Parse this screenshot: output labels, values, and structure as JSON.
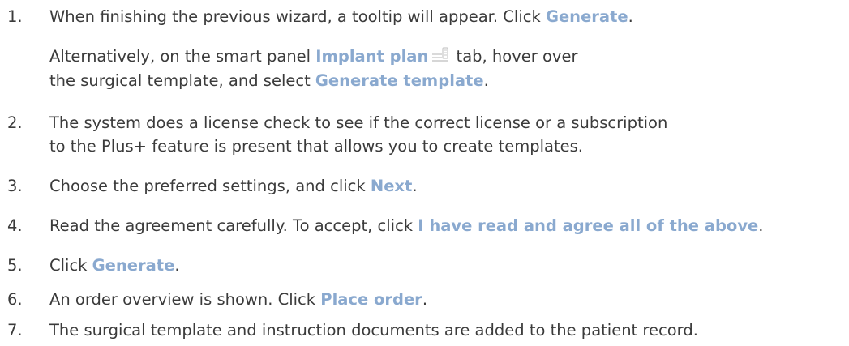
{
  "steps": [
    {
      "number": "1.",
      "text_before": "When finishing the previous wizard, a tooltip will appear. Click ",
      "action": "Generate",
      "text_after": ".",
      "alternative": {
        "line1_before": "Alternatively, on the smart panel ",
        "line1_action": "Implant plan",
        "line1_icon": "implant-plan-tab-icon",
        "line1_after": " tab, hover over",
        "line2_before": "the surgical template, and select ",
        "line2_action": "Generate template",
        "line2_after": "."
      }
    },
    {
      "number": "2.",
      "line1": "The system does a license check to see if the correct license or a subscription",
      "line2": "to the Plus+ feature is present that allows you to create templates."
    },
    {
      "number": "3.",
      "text_before": "Choose the preferred settings, and click ",
      "action": "Next",
      "text_after": "."
    },
    {
      "number": "4.",
      "text_before": "Read the agreement carefully. To accept, click ",
      "action": "I have read and agree all of the above",
      "text_after": "."
    },
    {
      "number": "5.",
      "text_before": "Click ",
      "action": "Generate",
      "text_after": "."
    },
    {
      "number": "6.",
      "text_before": "An order overview is shown. Click ",
      "action": "Place order",
      "text_after": "."
    },
    {
      "number": "7.",
      "line1": "The surgical template and instruction documents are added to the patient record."
    }
  ],
  "colors": {
    "body_text": "#3b3b3b",
    "ui_reference": "#8aa9cf"
  }
}
